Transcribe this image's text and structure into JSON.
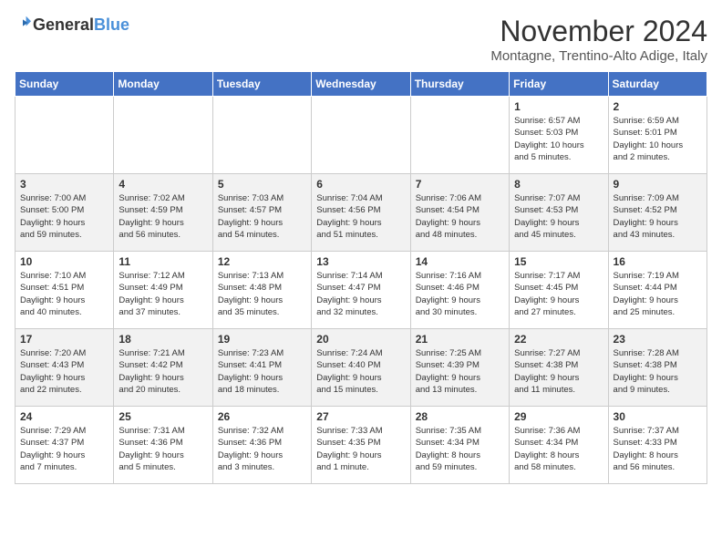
{
  "header": {
    "logo_line1": "General",
    "logo_line2": "Blue",
    "title": "November 2024",
    "subtitle": "Montagne, Trentino-Alto Adige, Italy"
  },
  "weekdays": [
    "Sunday",
    "Monday",
    "Tuesday",
    "Wednesday",
    "Thursday",
    "Friday",
    "Saturday"
  ],
  "weeks": [
    [
      {
        "day": "",
        "info": ""
      },
      {
        "day": "",
        "info": ""
      },
      {
        "day": "",
        "info": ""
      },
      {
        "day": "",
        "info": ""
      },
      {
        "day": "",
        "info": ""
      },
      {
        "day": "1",
        "info": "Sunrise: 6:57 AM\nSunset: 5:03 PM\nDaylight: 10 hours\nand 5 minutes."
      },
      {
        "day": "2",
        "info": "Sunrise: 6:59 AM\nSunset: 5:01 PM\nDaylight: 10 hours\nand 2 minutes."
      }
    ],
    [
      {
        "day": "3",
        "info": "Sunrise: 7:00 AM\nSunset: 5:00 PM\nDaylight: 9 hours\nand 59 minutes."
      },
      {
        "day": "4",
        "info": "Sunrise: 7:02 AM\nSunset: 4:59 PM\nDaylight: 9 hours\nand 56 minutes."
      },
      {
        "day": "5",
        "info": "Sunrise: 7:03 AM\nSunset: 4:57 PM\nDaylight: 9 hours\nand 54 minutes."
      },
      {
        "day": "6",
        "info": "Sunrise: 7:04 AM\nSunset: 4:56 PM\nDaylight: 9 hours\nand 51 minutes."
      },
      {
        "day": "7",
        "info": "Sunrise: 7:06 AM\nSunset: 4:54 PM\nDaylight: 9 hours\nand 48 minutes."
      },
      {
        "day": "8",
        "info": "Sunrise: 7:07 AM\nSunset: 4:53 PM\nDaylight: 9 hours\nand 45 minutes."
      },
      {
        "day": "9",
        "info": "Sunrise: 7:09 AM\nSunset: 4:52 PM\nDaylight: 9 hours\nand 43 minutes."
      }
    ],
    [
      {
        "day": "10",
        "info": "Sunrise: 7:10 AM\nSunset: 4:51 PM\nDaylight: 9 hours\nand 40 minutes."
      },
      {
        "day": "11",
        "info": "Sunrise: 7:12 AM\nSunset: 4:49 PM\nDaylight: 9 hours\nand 37 minutes."
      },
      {
        "day": "12",
        "info": "Sunrise: 7:13 AM\nSunset: 4:48 PM\nDaylight: 9 hours\nand 35 minutes."
      },
      {
        "day": "13",
        "info": "Sunrise: 7:14 AM\nSunset: 4:47 PM\nDaylight: 9 hours\nand 32 minutes."
      },
      {
        "day": "14",
        "info": "Sunrise: 7:16 AM\nSunset: 4:46 PM\nDaylight: 9 hours\nand 30 minutes."
      },
      {
        "day": "15",
        "info": "Sunrise: 7:17 AM\nSunset: 4:45 PM\nDaylight: 9 hours\nand 27 minutes."
      },
      {
        "day": "16",
        "info": "Sunrise: 7:19 AM\nSunset: 4:44 PM\nDaylight: 9 hours\nand 25 minutes."
      }
    ],
    [
      {
        "day": "17",
        "info": "Sunrise: 7:20 AM\nSunset: 4:43 PM\nDaylight: 9 hours\nand 22 minutes."
      },
      {
        "day": "18",
        "info": "Sunrise: 7:21 AM\nSunset: 4:42 PM\nDaylight: 9 hours\nand 20 minutes."
      },
      {
        "day": "19",
        "info": "Sunrise: 7:23 AM\nSunset: 4:41 PM\nDaylight: 9 hours\nand 18 minutes."
      },
      {
        "day": "20",
        "info": "Sunrise: 7:24 AM\nSunset: 4:40 PM\nDaylight: 9 hours\nand 15 minutes."
      },
      {
        "day": "21",
        "info": "Sunrise: 7:25 AM\nSunset: 4:39 PM\nDaylight: 9 hours\nand 13 minutes."
      },
      {
        "day": "22",
        "info": "Sunrise: 7:27 AM\nSunset: 4:38 PM\nDaylight: 9 hours\nand 11 minutes."
      },
      {
        "day": "23",
        "info": "Sunrise: 7:28 AM\nSunset: 4:38 PM\nDaylight: 9 hours\nand 9 minutes."
      }
    ],
    [
      {
        "day": "24",
        "info": "Sunrise: 7:29 AM\nSunset: 4:37 PM\nDaylight: 9 hours\nand 7 minutes."
      },
      {
        "day": "25",
        "info": "Sunrise: 7:31 AM\nSunset: 4:36 PM\nDaylight: 9 hours\nand 5 minutes."
      },
      {
        "day": "26",
        "info": "Sunrise: 7:32 AM\nSunset: 4:36 PM\nDaylight: 9 hours\nand 3 minutes."
      },
      {
        "day": "27",
        "info": "Sunrise: 7:33 AM\nSunset: 4:35 PM\nDaylight: 9 hours\nand 1 minute."
      },
      {
        "day": "28",
        "info": "Sunrise: 7:35 AM\nSunset: 4:34 PM\nDaylight: 8 hours\nand 59 minutes."
      },
      {
        "day": "29",
        "info": "Sunrise: 7:36 AM\nSunset: 4:34 PM\nDaylight: 8 hours\nand 58 minutes."
      },
      {
        "day": "30",
        "info": "Sunrise: 7:37 AM\nSunset: 4:33 PM\nDaylight: 8 hours\nand 56 minutes."
      }
    ]
  ]
}
